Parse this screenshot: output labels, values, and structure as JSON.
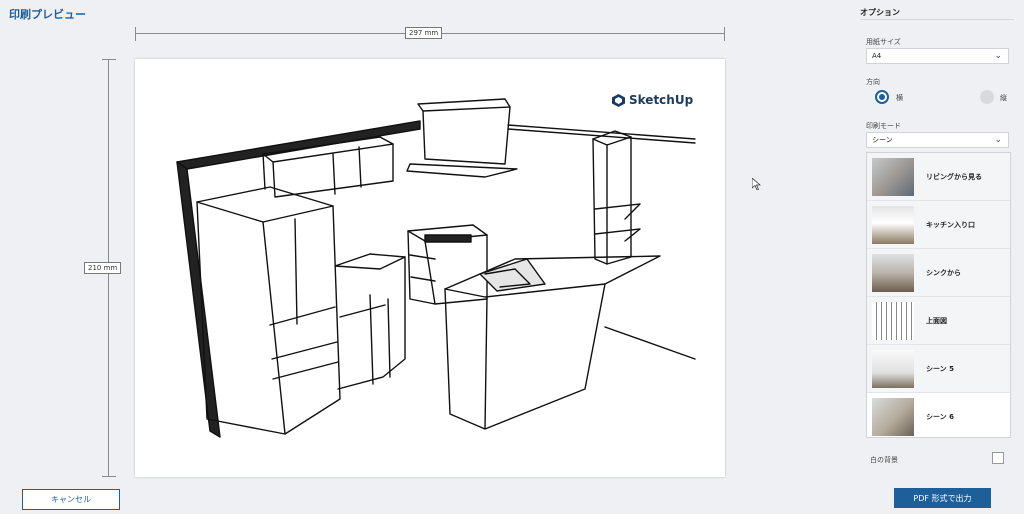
{
  "window": {
    "title": "印刷プレビュー"
  },
  "preview": {
    "width_label": "297 mm",
    "height_label": "210 mm",
    "logo_text": "SketchUp"
  },
  "footer": {
    "cancel_label": "キャンセル",
    "export_label": "PDF 形式で出力"
  },
  "options": {
    "title": "オプション",
    "paper_size": {
      "label": "用紙サイズ",
      "value": "A4"
    },
    "orientation": {
      "label": "方向",
      "landscape": "横",
      "portrait": "縦",
      "selected": "landscape"
    },
    "print_mode": {
      "label": "印刷モード",
      "value": "シーン"
    },
    "scenes": [
      {
        "label": "リビングから見る",
        "selected": false
      },
      {
        "label": "キッチン入り口",
        "selected": false
      },
      {
        "label": "シンクから",
        "selected": false
      },
      {
        "label": "上面図",
        "selected": false
      },
      {
        "label": "シーン 5",
        "selected": false
      },
      {
        "label": "シーン 6",
        "selected": true
      }
    ],
    "white_background": {
      "label": "白の背景",
      "checked": false
    }
  },
  "colors": {
    "accent": "#1d5f99",
    "panel_bg": "#eef0f3"
  },
  "icons": {
    "chevron": "chevron-down-icon",
    "logo": "sketchup-logo-icon",
    "cursor": "mouse-cursor-icon"
  }
}
